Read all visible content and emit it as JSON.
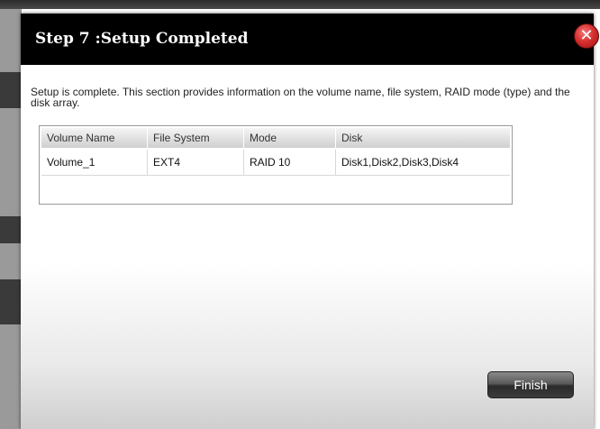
{
  "dialog": {
    "title": "Step 7 :Setup Completed",
    "close_glyph": "✕",
    "close_icon": "close-icon",
    "description": "Setup is complete. This section provides information on the volume name, file system, RAID mode (type) and the disk array.",
    "finish_label": "Finish"
  },
  "table": {
    "headers": [
      "Volume Name",
      "File System",
      "Mode",
      "Disk"
    ],
    "rows": [
      [
        "Volume_1",
        "EXT4",
        "RAID 10",
        "Disk1,Disk2,Disk3,Disk4"
      ]
    ]
  },
  "colors": {
    "titlebar": "#000000",
    "close_button": "#d83030",
    "finish_button": "#3c3c3c"
  }
}
